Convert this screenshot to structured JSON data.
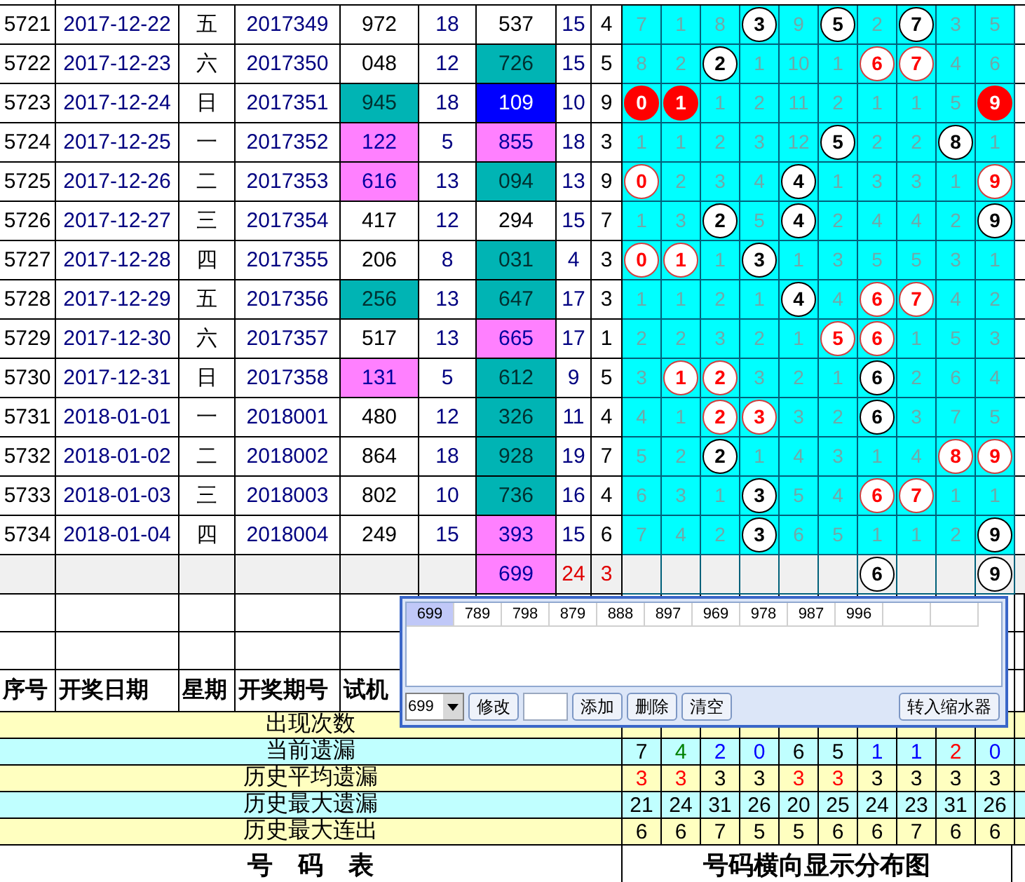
{
  "rows": [
    {
      "seq": "5721",
      "date": "2017-12-22",
      "week": "五",
      "issue": "2017349",
      "test": {
        "text": "972"
      },
      "sum": "18",
      "number": {
        "text": "537"
      },
      "span": "15",
      "extra": "4",
      "balls": [
        {
          "text": "7",
          "kind": "miss"
        },
        {
          "text": "1",
          "kind": "miss"
        },
        {
          "text": "8",
          "kind": "miss"
        },
        {
          "text": "3",
          "kind": "ball"
        },
        {
          "text": "9",
          "kind": "miss"
        },
        {
          "text": "5",
          "kind": "ball"
        },
        {
          "text": "2",
          "kind": "miss"
        },
        {
          "text": "7",
          "kind": "ball"
        },
        {
          "text": "3",
          "kind": "miss"
        },
        {
          "text": "5",
          "kind": "miss"
        }
      ]
    },
    {
      "seq": "5722",
      "date": "2017-12-23",
      "week": "六",
      "issue": "2017350",
      "test": {
        "text": "048"
      },
      "sum": "12",
      "number": {
        "text": "726",
        "color": "#00b4b4"
      },
      "span": "15",
      "extra": "5",
      "balls": [
        {
          "text": "8",
          "kind": "miss"
        },
        {
          "text": "2",
          "kind": "miss"
        },
        {
          "text": "2",
          "kind": "ball"
        },
        {
          "text": "1",
          "kind": "miss"
        },
        {
          "text": "10",
          "kind": "miss"
        },
        {
          "text": "1",
          "kind": "miss"
        },
        {
          "text": "6",
          "kind": "repeat"
        },
        {
          "text": "7",
          "kind": "repeat"
        },
        {
          "text": "4",
          "kind": "miss"
        },
        {
          "text": "6",
          "kind": "miss"
        }
      ]
    },
    {
      "seq": "5723",
      "date": "2017-12-24",
      "week": "日",
      "issue": "2017351",
      "test": {
        "text": "945",
        "color": "#00b4b4"
      },
      "sum": "18",
      "number": {
        "text": "109",
        "color": "#0000ff"
      },
      "span": "10",
      "extra": "9",
      "balls": [
        {
          "text": "0",
          "kind": "solid"
        },
        {
          "text": "1",
          "kind": "solid"
        },
        {
          "text": "1",
          "kind": "miss"
        },
        {
          "text": "2",
          "kind": "miss"
        },
        {
          "text": "11",
          "kind": "miss"
        },
        {
          "text": "2",
          "kind": "miss"
        },
        {
          "text": "1",
          "kind": "miss"
        },
        {
          "text": "1",
          "kind": "miss"
        },
        {
          "text": "5",
          "kind": "miss"
        },
        {
          "text": "9",
          "kind": "solid"
        }
      ]
    },
    {
      "seq": "5724",
      "date": "2017-12-25",
      "week": "一",
      "issue": "2017352",
      "test": {
        "text": "122",
        "color": "#ff80ff"
      },
      "sum": "5",
      "number": {
        "text": "855",
        "color": "#ff80ff"
      },
      "span": "18",
      "extra": "3",
      "balls": [
        {
          "text": "1",
          "kind": "miss"
        },
        {
          "text": "1",
          "kind": "miss"
        },
        {
          "text": "2",
          "kind": "miss"
        },
        {
          "text": "3",
          "kind": "miss"
        },
        {
          "text": "12",
          "kind": "miss"
        },
        {
          "text": "5",
          "kind": "ball"
        },
        {
          "text": "2",
          "kind": "miss"
        },
        {
          "text": "2",
          "kind": "miss"
        },
        {
          "text": "8",
          "kind": "ball"
        },
        {
          "text": "1",
          "kind": "miss"
        }
      ]
    },
    {
      "seq": "5725",
      "date": "2017-12-26",
      "week": "二",
      "issue": "2017353",
      "test": {
        "text": "616",
        "color": "#ff80ff"
      },
      "sum": "13",
      "number": {
        "text": "094",
        "color": "#00b4b4"
      },
      "span": "13",
      "extra": "9",
      "balls": [
        {
          "text": "0",
          "kind": "repeat"
        },
        {
          "text": "2",
          "kind": "miss"
        },
        {
          "text": "3",
          "kind": "miss"
        },
        {
          "text": "4",
          "kind": "miss"
        },
        {
          "text": "4",
          "kind": "ball"
        },
        {
          "text": "1",
          "kind": "miss"
        },
        {
          "text": "3",
          "kind": "miss"
        },
        {
          "text": "3",
          "kind": "miss"
        },
        {
          "text": "1",
          "kind": "miss"
        },
        {
          "text": "9",
          "kind": "repeat"
        }
      ]
    },
    {
      "seq": "5726",
      "date": "2017-12-27",
      "week": "三",
      "issue": "2017354",
      "test": {
        "text": "417"
      },
      "sum": "12",
      "number": {
        "text": "294"
      },
      "span": "15",
      "extra": "7",
      "balls": [
        {
          "text": "1",
          "kind": "miss"
        },
        {
          "text": "3",
          "kind": "miss"
        },
        {
          "text": "2",
          "kind": "ball"
        },
        {
          "text": "5",
          "kind": "miss"
        },
        {
          "text": "4",
          "kind": "ball"
        },
        {
          "text": "2",
          "kind": "miss"
        },
        {
          "text": "4",
          "kind": "miss"
        },
        {
          "text": "4",
          "kind": "miss"
        },
        {
          "text": "2",
          "kind": "miss"
        },
        {
          "text": "9",
          "kind": "ball"
        }
      ]
    },
    {
      "seq": "5727",
      "date": "2017-12-28",
      "week": "四",
      "issue": "2017355",
      "test": {
        "text": "206"
      },
      "sum": "8",
      "number": {
        "text": "031",
        "color": "#00b4b4"
      },
      "span": "4",
      "extra": "3",
      "balls": [
        {
          "text": "0",
          "kind": "repeat"
        },
        {
          "text": "1",
          "kind": "repeat"
        },
        {
          "text": "1",
          "kind": "miss"
        },
        {
          "text": "3",
          "kind": "ball"
        },
        {
          "text": "1",
          "kind": "miss"
        },
        {
          "text": "3",
          "kind": "miss"
        },
        {
          "text": "5",
          "kind": "miss"
        },
        {
          "text": "5",
          "kind": "miss"
        },
        {
          "text": "3",
          "kind": "miss"
        },
        {
          "text": "1",
          "kind": "miss"
        }
      ]
    },
    {
      "seq": "5728",
      "date": "2017-12-29",
      "week": "五",
      "issue": "2017356",
      "test": {
        "text": "256",
        "color": "#00b4b4"
      },
      "sum": "13",
      "number": {
        "text": "647",
        "color": "#00b4b4"
      },
      "span": "17",
      "extra": "3",
      "balls": [
        {
          "text": "1",
          "kind": "miss"
        },
        {
          "text": "1",
          "kind": "miss"
        },
        {
          "text": "2",
          "kind": "miss"
        },
        {
          "text": "1",
          "kind": "miss"
        },
        {
          "text": "4",
          "kind": "ball"
        },
        {
          "text": "4",
          "kind": "miss"
        },
        {
          "text": "6",
          "kind": "repeat"
        },
        {
          "text": "7",
          "kind": "repeat"
        },
        {
          "text": "4",
          "kind": "miss"
        },
        {
          "text": "2",
          "kind": "miss"
        }
      ]
    },
    {
      "seq": "5729",
      "date": "2017-12-30",
      "week": "六",
      "issue": "2017357",
      "test": {
        "text": "517"
      },
      "sum": "13",
      "number": {
        "text": "665",
        "color": "#ff80ff"
      },
      "span": "17",
      "extra": "1",
      "balls": [
        {
          "text": "2",
          "kind": "miss"
        },
        {
          "text": "2",
          "kind": "miss"
        },
        {
          "text": "3",
          "kind": "miss"
        },
        {
          "text": "2",
          "kind": "miss"
        },
        {
          "text": "1",
          "kind": "miss"
        },
        {
          "text": "5",
          "kind": "repeat"
        },
        {
          "text": "6",
          "kind": "repeat"
        },
        {
          "text": "1",
          "kind": "miss"
        },
        {
          "text": "5",
          "kind": "miss"
        },
        {
          "text": "3",
          "kind": "miss"
        }
      ]
    },
    {
      "seq": "5730",
      "date": "2017-12-31",
      "week": "日",
      "issue": "2017358",
      "test": {
        "text": "131",
        "color": "#ff80ff"
      },
      "sum": "5",
      "number": {
        "text": "612",
        "color": "#00b4b4"
      },
      "span": "9",
      "extra": "5",
      "balls": [
        {
          "text": "3",
          "kind": "miss"
        },
        {
          "text": "1",
          "kind": "repeat"
        },
        {
          "text": "2",
          "kind": "repeat"
        },
        {
          "text": "3",
          "kind": "miss"
        },
        {
          "text": "2",
          "kind": "miss"
        },
        {
          "text": "1",
          "kind": "miss"
        },
        {
          "text": "6",
          "kind": "ball"
        },
        {
          "text": "2",
          "kind": "miss"
        },
        {
          "text": "6",
          "kind": "miss"
        },
        {
          "text": "4",
          "kind": "miss"
        }
      ]
    },
    {
      "seq": "5731",
      "date": "2018-01-01",
      "week": "一",
      "issue": "2018001",
      "test": {
        "text": "480"
      },
      "sum": "12",
      "number": {
        "text": "326",
        "color": "#00b4b4"
      },
      "span": "11",
      "extra": "4",
      "balls": [
        {
          "text": "4",
          "kind": "miss"
        },
        {
          "text": "1",
          "kind": "miss"
        },
        {
          "text": "2",
          "kind": "repeat"
        },
        {
          "text": "3",
          "kind": "repeat"
        },
        {
          "text": "3",
          "kind": "miss"
        },
        {
          "text": "2",
          "kind": "miss"
        },
        {
          "text": "6",
          "kind": "ball"
        },
        {
          "text": "3",
          "kind": "miss"
        },
        {
          "text": "7",
          "kind": "miss"
        },
        {
          "text": "5",
          "kind": "miss"
        }
      ]
    },
    {
      "seq": "5732",
      "date": "2018-01-02",
      "week": "二",
      "issue": "2018002",
      "test": {
        "text": "864"
      },
      "sum": "18",
      "number": {
        "text": "928",
        "color": "#00b4b4"
      },
      "span": "19",
      "extra": "7",
      "balls": [
        {
          "text": "5",
          "kind": "miss"
        },
        {
          "text": "2",
          "kind": "miss"
        },
        {
          "text": "2",
          "kind": "ball"
        },
        {
          "text": "1",
          "kind": "miss"
        },
        {
          "text": "4",
          "kind": "miss"
        },
        {
          "text": "3",
          "kind": "miss"
        },
        {
          "text": "1",
          "kind": "miss"
        },
        {
          "text": "4",
          "kind": "miss"
        },
        {
          "text": "8",
          "kind": "repeat"
        },
        {
          "text": "9",
          "kind": "repeat"
        }
      ]
    },
    {
      "seq": "5733",
      "date": "2018-01-03",
      "week": "三",
      "issue": "2018003",
      "test": {
        "text": "802"
      },
      "sum": "10",
      "number": {
        "text": "736",
        "color": "#00b4b4"
      },
      "span": "16",
      "extra": "4",
      "balls": [
        {
          "text": "6",
          "kind": "miss"
        },
        {
          "text": "3",
          "kind": "miss"
        },
        {
          "text": "1",
          "kind": "miss"
        },
        {
          "text": "3",
          "kind": "ball"
        },
        {
          "text": "5",
          "kind": "miss"
        },
        {
          "text": "4",
          "kind": "miss"
        },
        {
          "text": "6",
          "kind": "repeat"
        },
        {
          "text": "7",
          "kind": "repeat"
        },
        {
          "text": "1",
          "kind": "miss"
        },
        {
          "text": "1",
          "kind": "miss"
        }
      ]
    },
    {
      "seq": "5734",
      "date": "2018-01-04",
      "week": "四",
      "issue": "2018004",
      "test": {
        "text": "249"
      },
      "sum": "15",
      "number": {
        "text": "393",
        "color": "#ff80ff"
      },
      "span": "15",
      "extra": "6",
      "balls": [
        {
          "text": "7",
          "kind": "miss"
        },
        {
          "text": "4",
          "kind": "miss"
        },
        {
          "text": "2",
          "kind": "miss"
        },
        {
          "text": "3",
          "kind": "ball"
        },
        {
          "text": "6",
          "kind": "miss"
        },
        {
          "text": "5",
          "kind": "miss"
        },
        {
          "text": "1",
          "kind": "miss"
        },
        {
          "text": "1",
          "kind": "miss"
        },
        {
          "text": "2",
          "kind": "miss"
        },
        {
          "text": "9",
          "kind": "ball"
        }
      ]
    }
  ],
  "pending_row": {
    "number": {
      "text": "699",
      "color": "#ff80ff"
    },
    "span": "24",
    "extra": "3",
    "balls": [
      {
        "kind": "blank"
      },
      {
        "kind": "blank"
      },
      {
        "kind": "blank"
      },
      {
        "kind": "blank"
      },
      {
        "kind": "blank"
      },
      {
        "kind": "blank"
      },
      {
        "text": "6",
        "kind": "ball"
      },
      {
        "kind": "blank"
      },
      {
        "kind": "blank"
      },
      {
        "text": "9",
        "kind": "ball"
      }
    ]
  },
  "header": [
    "序号",
    "开奖日期",
    "星期",
    "开奖期号",
    "试机"
  ],
  "stats": [
    {
      "label": "出现次数"
    },
    {
      "label": "当前遗漏",
      "values": [
        {
          "text": "7",
          "color": "#000000"
        },
        {
          "text": "4",
          "color": "#008000"
        },
        {
          "text": "2",
          "color": "#0000ff"
        },
        {
          "text": "0",
          "color": "#0000ff"
        },
        {
          "text": "6",
          "color": "#000000"
        },
        {
          "text": "5",
          "color": "#000000"
        },
        {
          "text": "1",
          "color": "#0000ff"
        },
        {
          "text": "1",
          "color": "#0000ff"
        },
        {
          "text": "2",
          "color": "#ff0000"
        },
        {
          "text": "0",
          "color": "#0000ff"
        }
      ]
    },
    {
      "label": "历史平均遗漏",
      "values": [
        {
          "text": "3",
          "color": "#ff0000"
        },
        {
          "text": "3",
          "color": "#ff0000"
        },
        {
          "text": "3",
          "color": "#000000"
        },
        {
          "text": "3",
          "color": "#000000"
        },
        {
          "text": "3",
          "color": "#ff0000"
        },
        {
          "text": "3",
          "color": "#ff0000"
        },
        {
          "text": "3",
          "color": "#000000"
        },
        {
          "text": "3",
          "color": "#000000"
        },
        {
          "text": "3",
          "color": "#000000"
        },
        {
          "text": "3",
          "color": "#000000"
        }
      ]
    },
    {
      "label": "历史最大遗漏",
      "values": [
        {
          "text": "21",
          "color": "#000000"
        },
        {
          "text": "24",
          "color": "#000000"
        },
        {
          "text": "31",
          "color": "#000000"
        },
        {
          "text": "26",
          "color": "#000000"
        },
        {
          "text": "20",
          "color": "#000000"
        },
        {
          "text": "25",
          "color": "#000000"
        },
        {
          "text": "24",
          "color": "#000000"
        },
        {
          "text": "23",
          "color": "#000000"
        },
        {
          "text": "31",
          "color": "#000000"
        },
        {
          "text": "26",
          "color": "#000000"
        }
      ]
    },
    {
      "label": "历史最大连出",
      "values": [
        {
          "text": "6",
          "color": "#000000"
        },
        {
          "text": "6",
          "color": "#000000"
        },
        {
          "text": "7",
          "color": "#000000"
        },
        {
          "text": "5",
          "color": "#000000"
        },
        {
          "text": "5",
          "color": "#000000"
        },
        {
          "text": "6",
          "color": "#000000"
        },
        {
          "text": "6",
          "color": "#000000"
        },
        {
          "text": "7",
          "color": "#000000"
        },
        {
          "text": "6",
          "color": "#000000"
        },
        {
          "text": "6",
          "color": "#000000"
        }
      ]
    }
  ],
  "footer": {
    "left": "号　码　表",
    "right": "号码横向显示分布图"
  },
  "popup": {
    "numbers": [
      {
        "text": "699",
        "selected": true
      },
      {
        "text": "789",
        "selected": false
      },
      {
        "text": "798",
        "selected": false
      },
      {
        "text": "879",
        "selected": false
      },
      {
        "text": "888",
        "selected": false
      },
      {
        "text": "897",
        "selected": false
      },
      {
        "text": "969",
        "selected": false
      },
      {
        "text": "978",
        "selected": false
      },
      {
        "text": "987",
        "selected": false
      },
      {
        "text": "996",
        "selected": false
      }
    ],
    "select_value": "699",
    "edit_button": "修改",
    "buttons": [
      "添加",
      "删除",
      "清空"
    ],
    "transfer_button": "转入缩水器"
  }
}
